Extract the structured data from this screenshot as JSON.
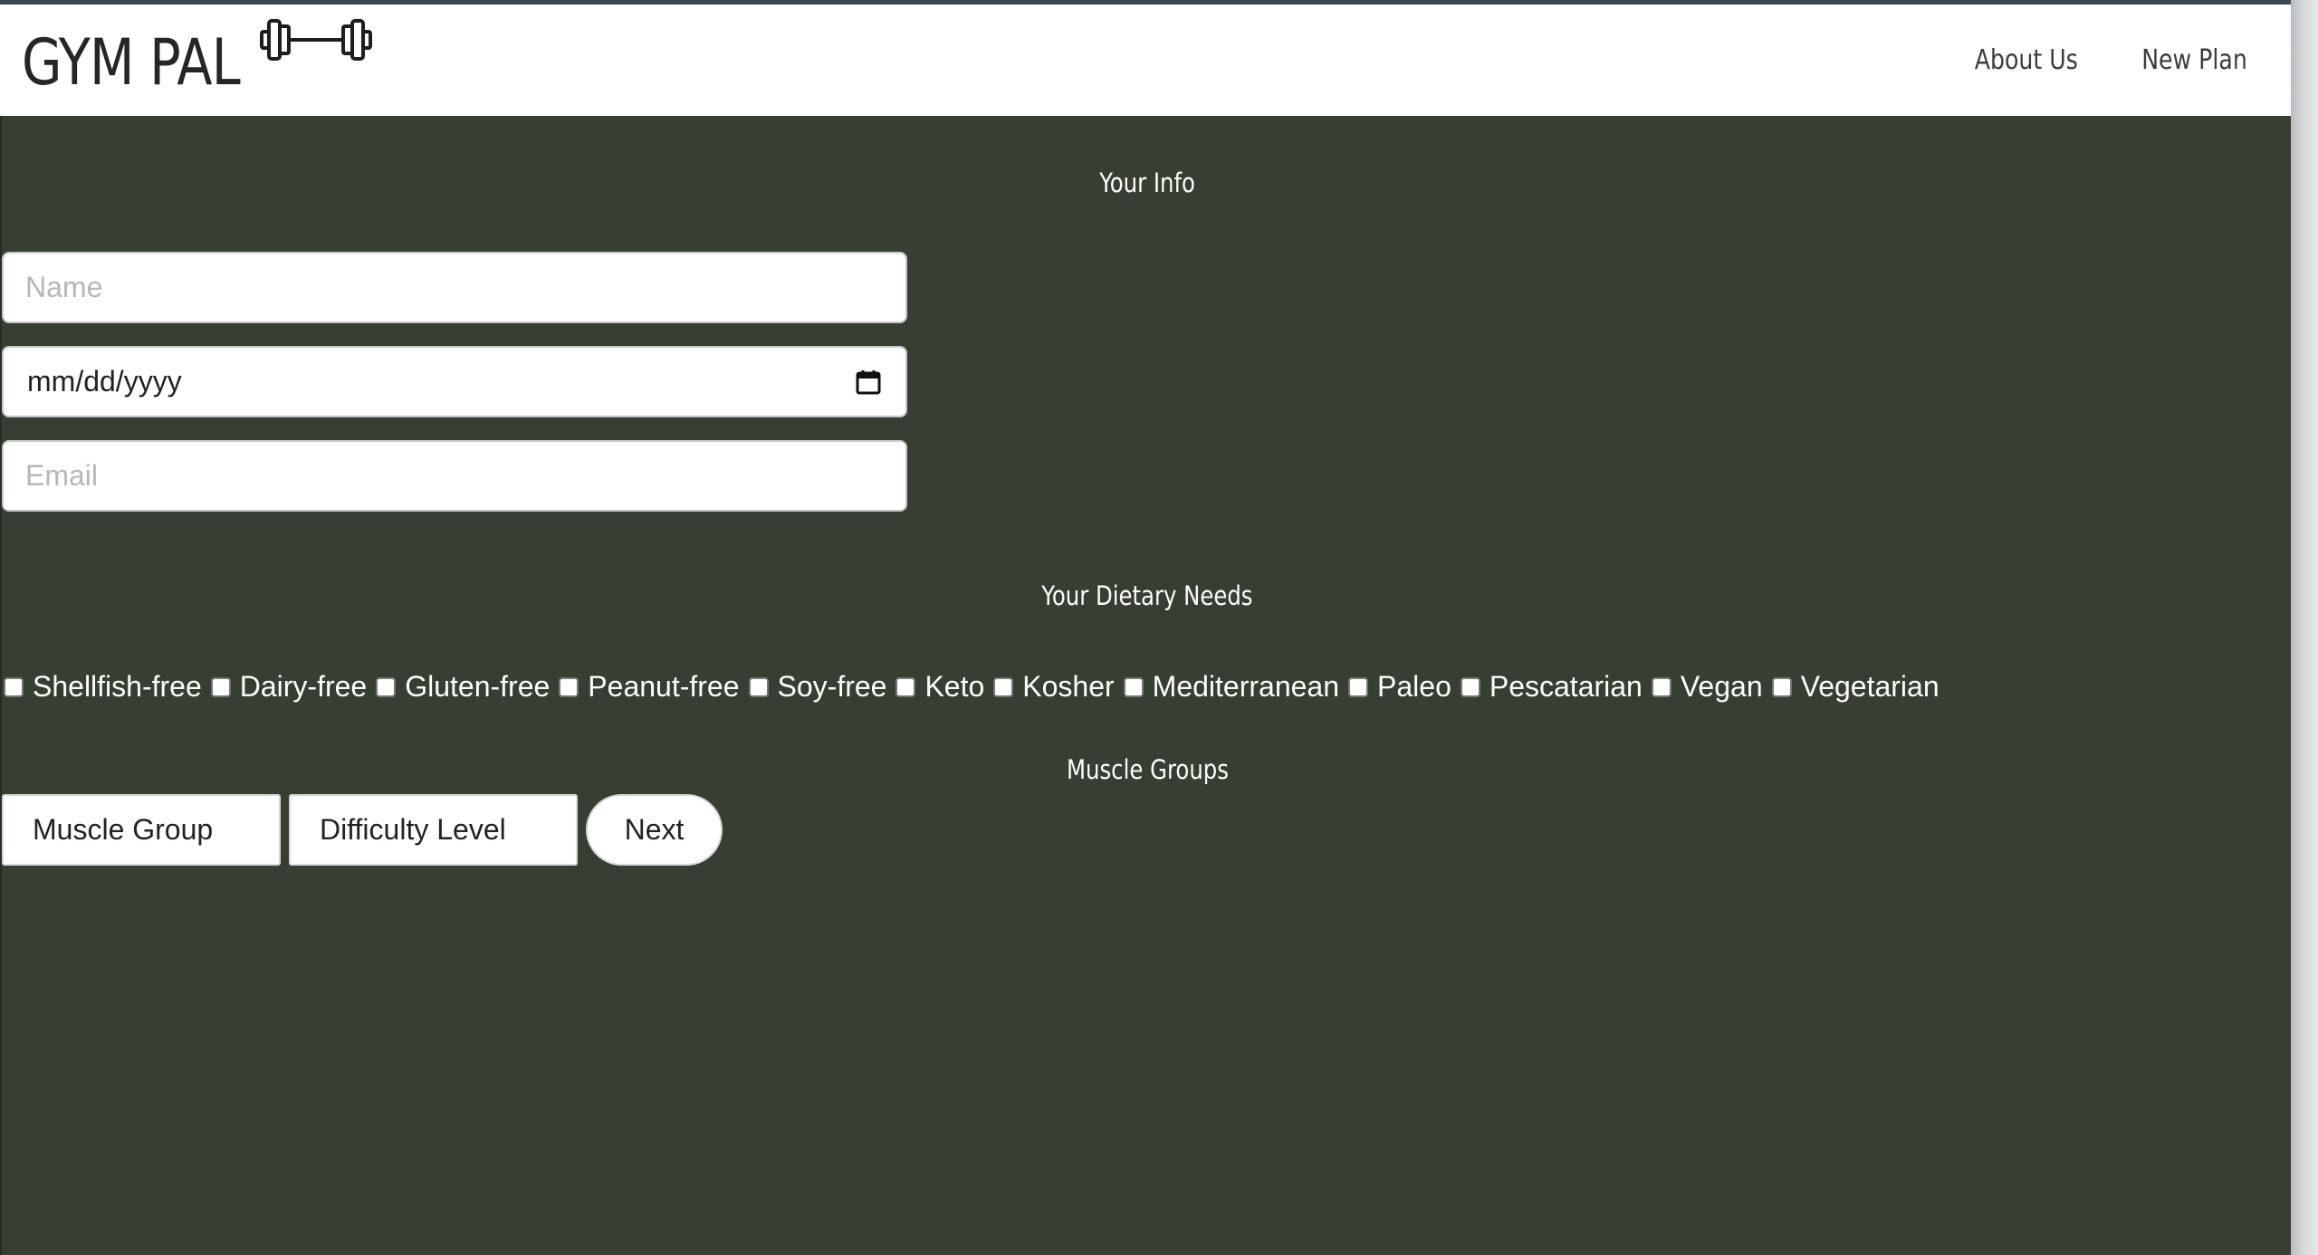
{
  "header": {
    "brand": "GYM PAL",
    "brand_icon": "barbell-icon",
    "nav": [
      {
        "label": "About Us"
      },
      {
        "label": "New Plan"
      }
    ]
  },
  "info_section": {
    "title": "Your Info",
    "name_placeholder": "Name",
    "dob_value": "mm/dd/yyyy",
    "email_placeholder": "Email"
  },
  "diet_section": {
    "title": "Your Dietary Needs",
    "options": [
      {
        "label": "Shellfish-free",
        "checked": false
      },
      {
        "label": "Dairy-free",
        "checked": false
      },
      {
        "label": "Gluten-free",
        "checked": false
      },
      {
        "label": "Peanut-free",
        "checked": false
      },
      {
        "label": "Soy-free",
        "checked": false
      },
      {
        "label": "Keto",
        "checked": false
      },
      {
        "label": "Kosher",
        "checked": false
      },
      {
        "label": "Mediterranean",
        "checked": false
      },
      {
        "label": "Paleo",
        "checked": false
      },
      {
        "label": "Pescatarian",
        "checked": false
      },
      {
        "label": "Vegan",
        "checked": false
      },
      {
        "label": "Vegetarian",
        "checked": false
      }
    ]
  },
  "muscle_section": {
    "title": "Muscle Groups",
    "muscle_group_label": "Muscle Group",
    "difficulty_label": "Difficulty Level",
    "next_label": "Next"
  },
  "colors": {
    "background": "#363f31",
    "header": "#ffffff",
    "top_border": "#3b4954"
  }
}
